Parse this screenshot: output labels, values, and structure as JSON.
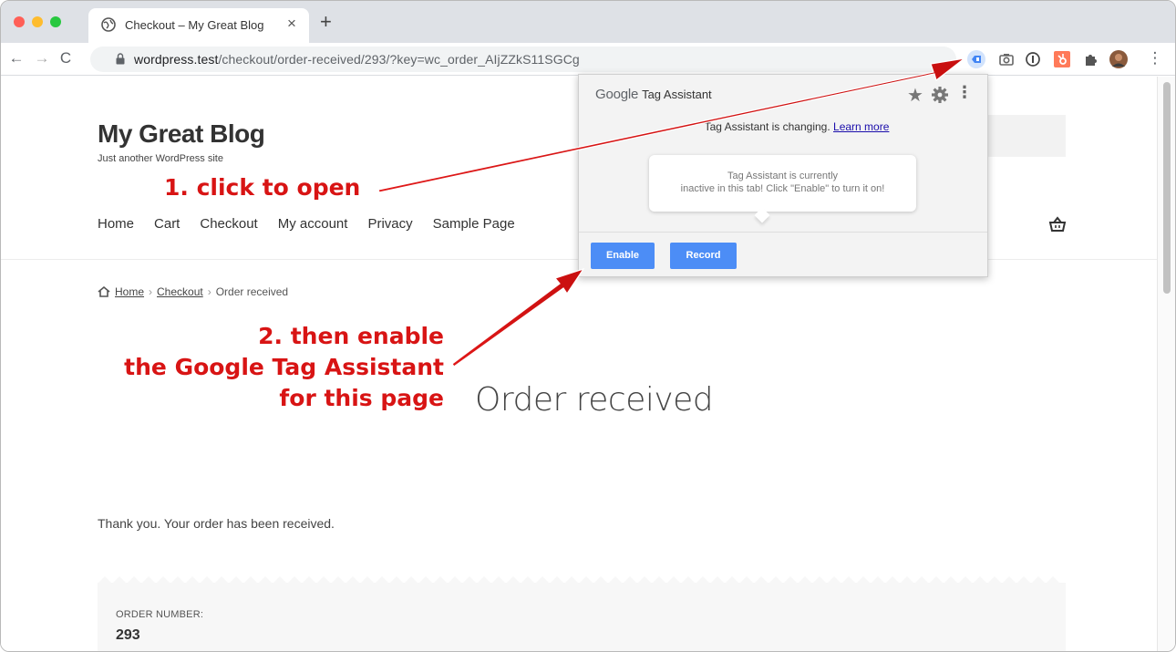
{
  "browser": {
    "tab_title": "Checkout – My Great Blog",
    "tab_close": "×",
    "new_tab": "+",
    "url_host": "wordpress.test",
    "url_path": "/checkout/order-received/293/?key=wc_order_AIjZZkS11SGCg",
    "nav_back": "←",
    "nav_forward": "→",
    "nav_reload": "C",
    "more_menu": "⋮"
  },
  "site": {
    "title": "My Great Blog",
    "tagline": "Just another WordPress site",
    "nav": [
      "Home",
      "Cart",
      "Checkout",
      "My account",
      "Privacy",
      "Sample Page"
    ],
    "breadcrumb": {
      "home": "Home",
      "checkout": "Checkout",
      "current": "Order received",
      "sep": "›"
    },
    "heading": "Order received",
    "thank_you": "Thank you. Your order has been received.",
    "order_number_label": "ORDER NUMBER:",
    "order_number": "293"
  },
  "tag_assistant": {
    "brand_google": "Google",
    "brand_product": "Tag Assistant",
    "notice_text": "Tag Assistant is changing.",
    "notice_link": "Learn more",
    "bubble_line1": "Tag Assistant is currently",
    "bubble_line2": "inactive in this tab! Click \"Enable\" to turn it on!",
    "star": "★",
    "more": "⋮",
    "enable_label": "Enable",
    "record_label": "Record"
  },
  "annotations": {
    "step1": "1. click to open",
    "step2_line1": "2. then enable",
    "step2_line2": "the Google Tag Assistant",
    "step2_line3": "for this page"
  },
  "colors": {
    "annotation_red": "#d81414",
    "button_blue": "#4c8df6"
  }
}
